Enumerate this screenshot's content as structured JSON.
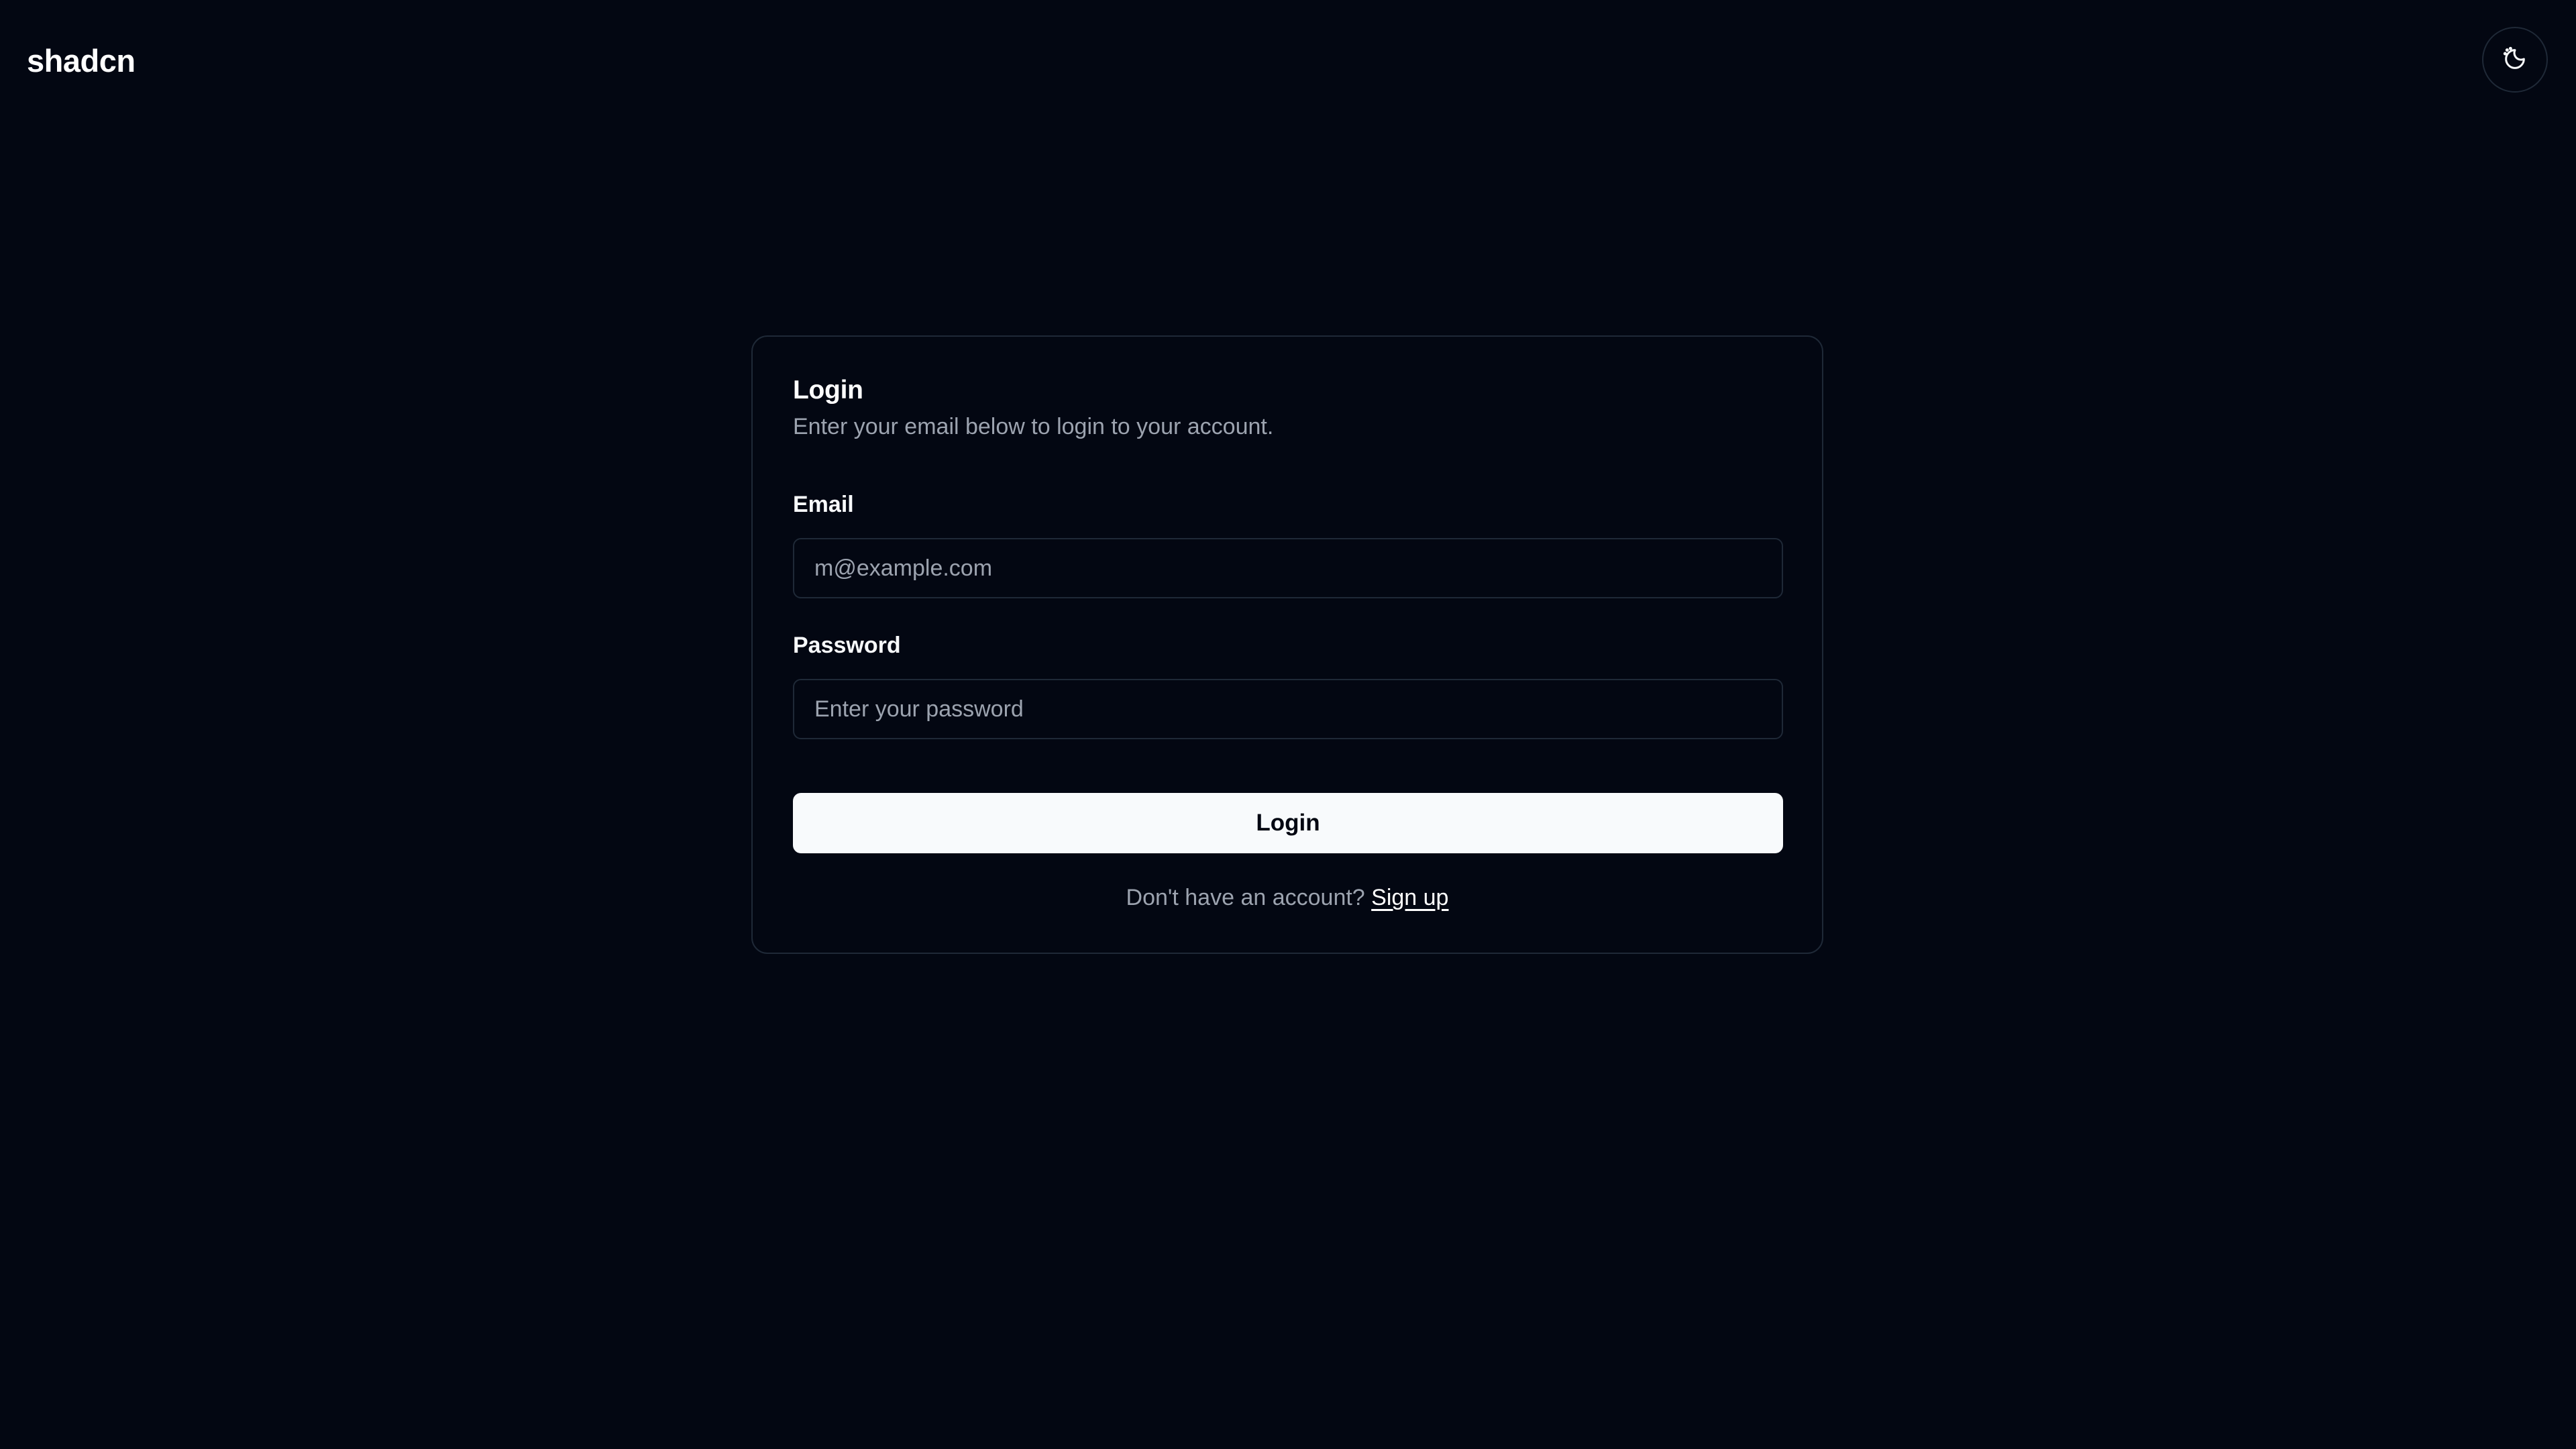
{
  "header": {
    "brand": "shadcn",
    "theme_toggle_icon": "moon-sun-icon"
  },
  "login_card": {
    "title": "Login",
    "description": "Enter your email below to login to your account.",
    "email": {
      "label": "Email",
      "value": "",
      "placeholder": "m@example.com"
    },
    "password": {
      "label": "Password",
      "value": "",
      "placeholder": "Enter your password"
    },
    "submit_label": "Login",
    "signup_prompt": "Don't have an account?",
    "signup_link": "Sign up"
  },
  "colors": {
    "background": "#030712",
    "border": "#1f2937",
    "muted_text": "#9ca3af",
    "primary_button": "#f8fafc"
  }
}
